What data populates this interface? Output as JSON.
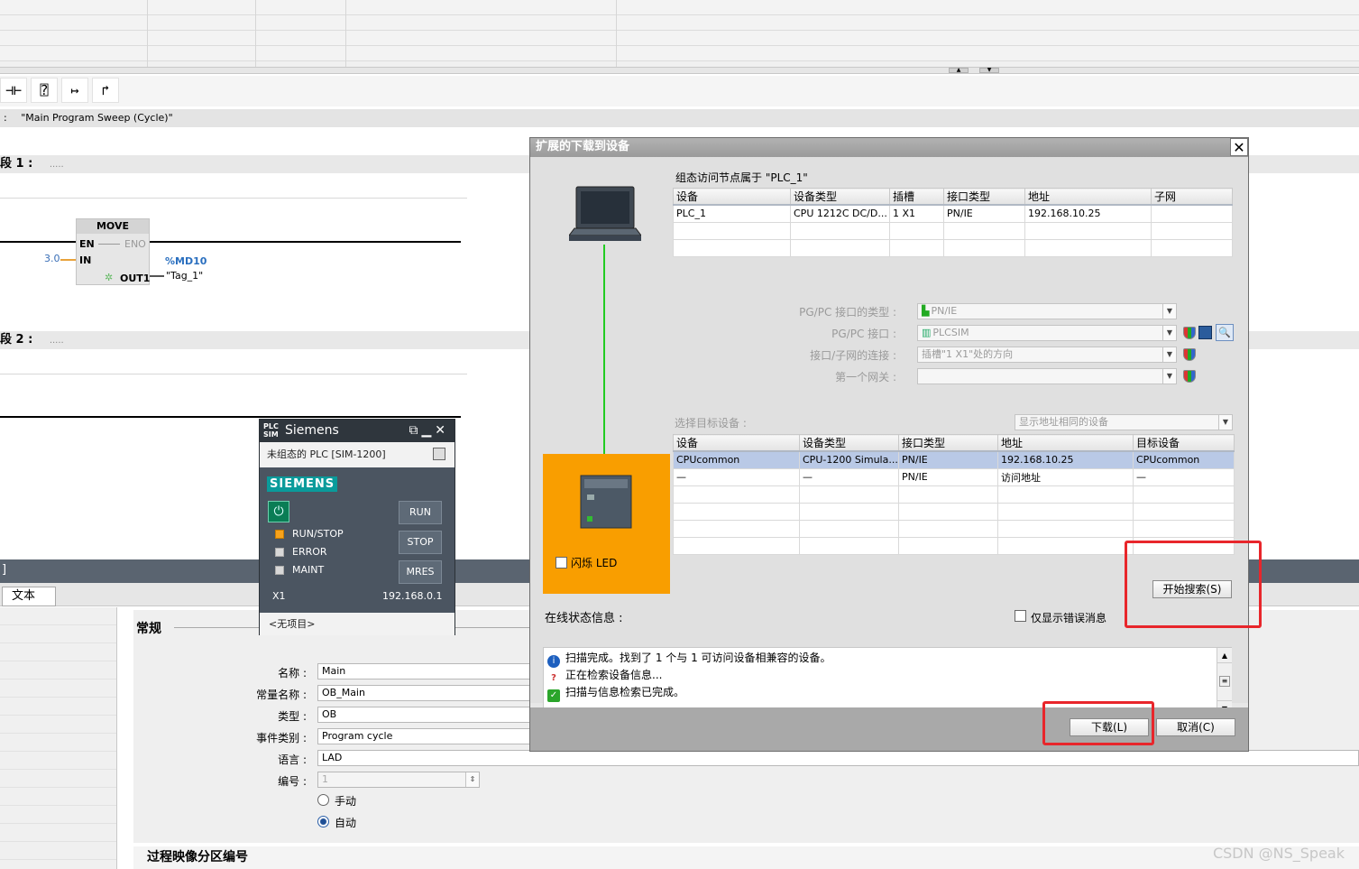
{
  "editor": {
    "block_title_prefix": ":",
    "block_title": "\"Main Program Sweep (Cycle)\"",
    "toolbar_icons": [
      "contact-icon",
      "box-icon",
      "open-branch-icon",
      "close-branch-icon"
    ],
    "network1": {
      "label": "段 1 :",
      "comment": "....."
    },
    "network2": {
      "label": "段 2 :",
      "comment": "....."
    },
    "move": {
      "name": "MOVE",
      "en": "EN",
      "eno": "ENO",
      "in": "IN",
      "out": "OUT1",
      "in_value": "3.0",
      "out_address": "%MD10",
      "out_tag": "\"Tag_1\""
    }
  },
  "plcsim": {
    "title": "Siemens",
    "logo_top": "PLC",
    "logo_bottom": "SIM",
    "subtitle": "未组态的 PLC [SIM-1200]",
    "brand": "SIEMENS",
    "leds": [
      "RUN/STOP",
      "ERROR",
      "MAINT"
    ],
    "buttons": [
      "RUN",
      "STOP",
      "MRES"
    ],
    "port": "X1",
    "ip": "192.168.0.1",
    "project": "<无项目>"
  },
  "properties": {
    "bar_text": "]",
    "tab": "文本",
    "section": "常规",
    "fields": [
      {
        "label": "名称 :",
        "value": "Main"
      },
      {
        "label": "常量名称 :",
        "value": "OB_Main"
      },
      {
        "label": "类型 :",
        "value": "OB"
      },
      {
        "label": "事件类别 :",
        "value": "Program cycle"
      },
      {
        "label": "语言 :",
        "value": "LAD"
      },
      {
        "label": "编号 :",
        "value": "1"
      }
    ],
    "radio_manual": "手动",
    "radio_auto": "自动",
    "bottom_heading": "过程映像分区编号"
  },
  "dialog": {
    "title": "扩展的下载到设备",
    "close": "✕",
    "config_heading": "组态访问节点属于 \"PLC_1\"",
    "config_columns": [
      "设备",
      "设备类型",
      "插槽",
      "接口类型",
      "地址",
      "子网"
    ],
    "config_rows": [
      [
        "PLC_1",
        "CPU 1212C DC/D...",
        "1 X1",
        "PN/IE",
        "192.168.10.25",
        ""
      ]
    ],
    "interface_fields": [
      {
        "label": "PG/PC 接口的类型 :",
        "value": "PN/IE"
      },
      {
        "label": "PG/PC 接口 :",
        "value": "PLCSIM"
      },
      {
        "label": "接口/子网的连接 :",
        "value": "插槽\"1 X1\"处的方向"
      },
      {
        "label": "第一个网关 :",
        "value": ""
      }
    ],
    "target_label": "选择目标设备 :",
    "target_filter": "显示地址相同的设备",
    "target_columns": [
      "设备",
      "设备类型",
      "接口类型",
      "地址",
      "目标设备"
    ],
    "target_rows": [
      [
        "CPUcommon",
        "CPU-1200 Simula...",
        "PN/IE",
        "192.168.10.25",
        "CPUcommon"
      ],
      [
        "—",
        "—",
        "PN/IE",
        "访问地址",
        "—"
      ]
    ],
    "flash_led": "闪烁 LED",
    "search_button": "开始搜索(S)",
    "status_heading": "在线状态信息 :",
    "errors_only": "仅显示错误消息",
    "status_messages": [
      {
        "icon": "info-icon",
        "text": "扫描完成。找到了 1 个与 1 可访问设备相兼容的设备。"
      },
      {
        "icon": "search-device-icon",
        "text": "正在检索设备信息..."
      },
      {
        "icon": "check-icon",
        "text": "扫描与信息检索已完成。"
      }
    ],
    "download_button": "下载(L)",
    "cancel_button": "取消(C)"
  },
  "watermark": "CSDN @NS_Speak",
  "colors": {
    "accent_orange": "#f99e00",
    "highlight": "#e8262b",
    "link_green": "#22cc22",
    "siemens_teal": "#0a9b9b"
  }
}
